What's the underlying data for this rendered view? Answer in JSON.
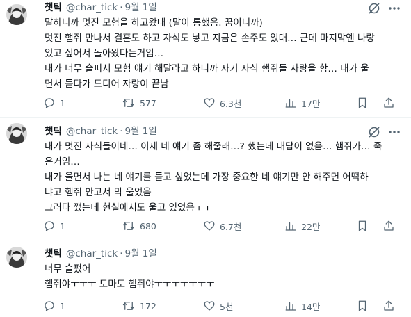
{
  "tweets": [
    {
      "name": "챗틱",
      "handle": "@char_tick",
      "sep": "·",
      "date": "9월 1일",
      "lines": [
        "말하니까 멋진 모험을 하고왔대 (말이 통했음. 꿈이니까)",
        "멋진 햄쥐 만나서 결혼도 하고 자식도 낳고 지금은 손주도 있대… 근데 마지막엔 나랑",
        "있고 싶어서 돌아왔다는거임…",
        "내가 너무 슬퍼서 모험 얘기 해달라고 하니까 자기 자식 햄쥐들 자랑을 함… 내가 울",
        "면서 듣다가 드디어 자랑이 끝남"
      ],
      "replies": "1",
      "retweets": "577",
      "likes": "6.3천",
      "views": "17만"
    },
    {
      "name": "챗틱",
      "handle": "@char_tick",
      "sep": "·",
      "date": "9월 1일",
      "lines": [
        "내가 멋진 자식들이네… 이제 네 얘기 좀 해줄래…? 했는데 대답이 없음… 햄쥐가… 죽",
        "은거임…",
        "내가 울면서 나는 네 얘기를 듣고 싶었는데 가장 중요한 네 얘기만 안 해주면 어떡하",
        "냐고 햄쥐 안고서 막 울었음",
        "그러다 깼는데 현실에서도 울고 있었음ㅜㅜ"
      ],
      "replies": "1",
      "retweets": "680",
      "likes": "6.7천",
      "views": "22만"
    },
    {
      "name": "챗틱",
      "handle": "@char_tick",
      "sep": "·",
      "date": "9월 1일",
      "lines": [
        "너무 슬펐어",
        "햄쥐야ㅜㅜㅜ 토마토 햄쥐야ㅜㅜㅜㅜㅜㅜㅜ"
      ],
      "replies": "1",
      "retweets": "172",
      "likes": "5천",
      "views": "14만"
    }
  ],
  "icons": {
    "grok": "grok-icon",
    "more": "more-icon",
    "reply": "reply-icon",
    "retweet": "retweet-icon",
    "like": "heart-icon",
    "views": "views-icon",
    "bookmark": "bookmark-icon",
    "share": "share-icon"
  },
  "colors": {
    "text": "#0f1419",
    "muted": "#536471",
    "border": "#eff3f4"
  }
}
